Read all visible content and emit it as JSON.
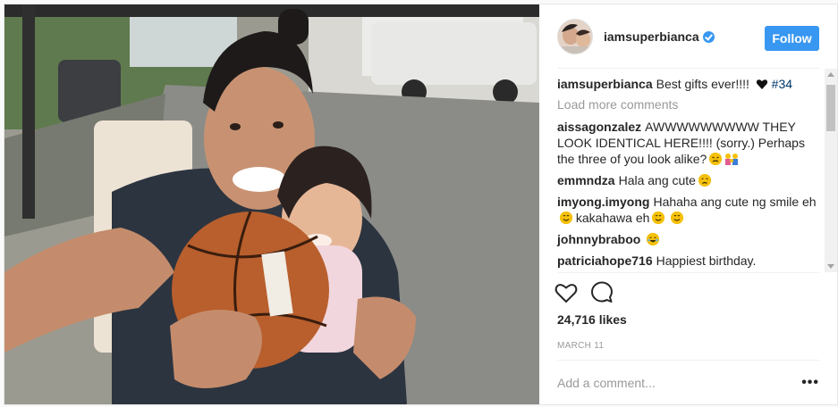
{
  "header": {
    "username": "iamsuperbianca",
    "follow_label": "Follow"
  },
  "caption": {
    "username": "iamsuperbianca",
    "text": "Best gifts ever!!!! ",
    "hashtag": "#34"
  },
  "load_more_label": "Load more comments",
  "comments": [
    {
      "user": "aissagonzalez",
      "text": "AWWWWWWWWW THEY LOOK IDENTICAL HERE!!!! (sorry.) Perhaps the three of you look alike?"
    },
    {
      "user": "emmndza",
      "text": "Hala ang cute"
    },
    {
      "user": "imyong.imyong",
      "text": "Hahaha ang cute ng smile eh",
      "text2": " kakahawa eh"
    },
    {
      "user": "johnnybraboo",
      "text": ""
    },
    {
      "user": "patriciahope716",
      "text": "Happiest birthday."
    }
  ],
  "likes": "24,716 likes",
  "date": "MARCH 11",
  "add_comment_placeholder": "Add a comment...",
  "more_options": "•••",
  "icons": {
    "like": "heart-outline-icon",
    "comment": "speech-bubble-icon",
    "verified": "verified-badge-icon",
    "more": "ellipsis-icon"
  },
  "colors": {
    "accent": "#3897f0",
    "text": "#262626",
    "muted": "#999999",
    "hashtag": "#003569"
  }
}
